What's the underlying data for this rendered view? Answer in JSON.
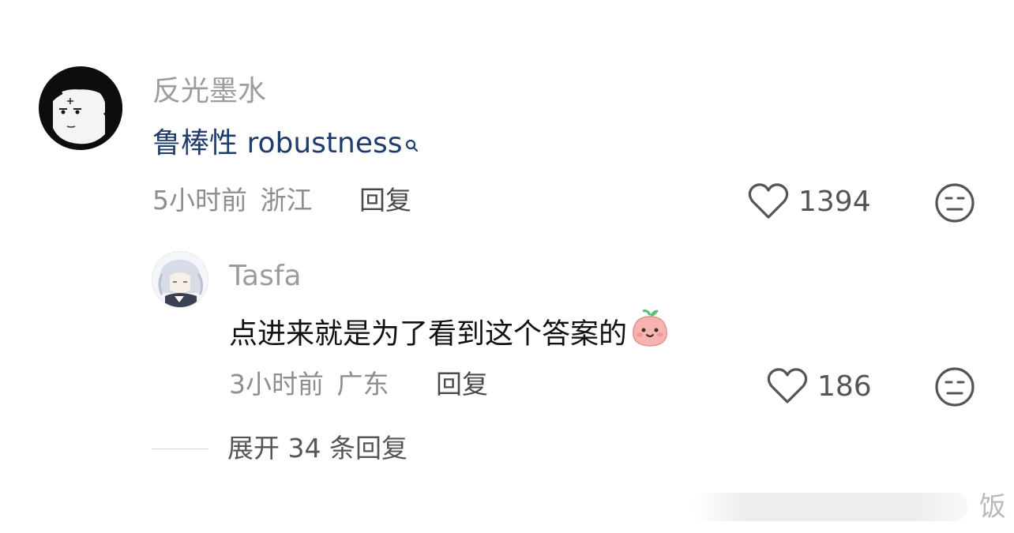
{
  "comments": [
    {
      "username": "反光墨水",
      "content": "鲁棒性 robustness",
      "search_icon": "search-icon",
      "time": "5小时前",
      "location": "浙江",
      "reply_label": "回复",
      "likes": "1394",
      "like_icon": "heart-outline-icon",
      "reaction_icon": "meh-face-icon",
      "content_color": "#1f3c6e",
      "reply": {
        "username": "Tasfa",
        "content": "点进来就是为了看到这个答案的",
        "emoji_icon": "peach-smile-emoji",
        "time": "3小时前",
        "location": "广东",
        "reply_label": "回复",
        "likes": "186",
        "like_icon": "heart-outline-icon",
        "reaction_icon": "meh-face-icon"
      },
      "expand_label": "展开 34 条回复"
    }
  ],
  "watermark": {
    "text": "饭"
  }
}
